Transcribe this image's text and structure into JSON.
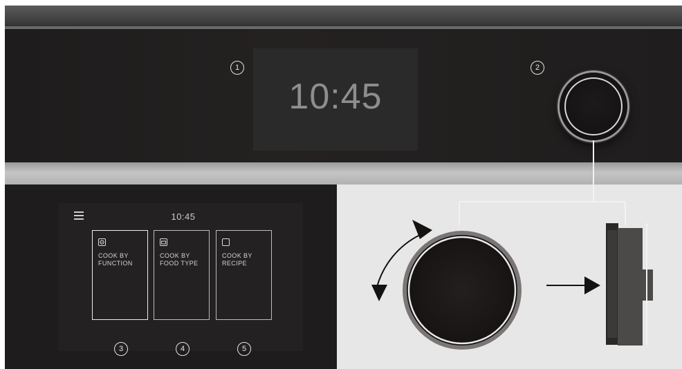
{
  "display": {
    "time": "10:45"
  },
  "callouts": [
    "1",
    "2",
    "3",
    "4",
    "5"
  ],
  "screen": {
    "time": "10:45",
    "menu_icon": "hamburger-icon",
    "cards": [
      {
        "label": "COOK BY FUNCTION",
        "icon": "fan-icon"
      },
      {
        "label": "COOK BY FOOD TYPE",
        "icon": "pot-icon"
      },
      {
        "label": "COOK BY RECIPE",
        "icon": "book-icon"
      }
    ]
  },
  "colors": {
    "panel": "#1e1c1c",
    "display_text": "#8e8e8e",
    "illustration_background": "#e7e7e7",
    "line": "#f2f2f2"
  }
}
